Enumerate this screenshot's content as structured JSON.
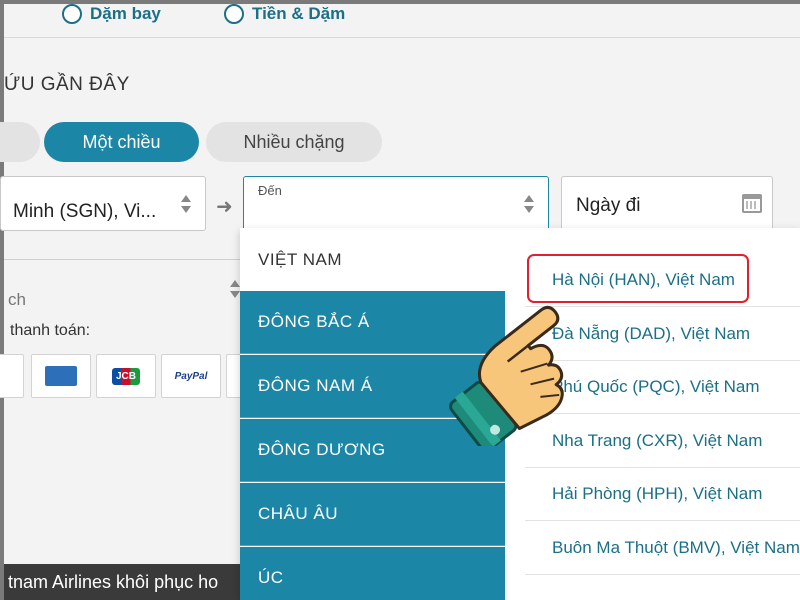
{
  "fare_options": {
    "miles": "Dặm bay",
    "cash_miles": "Tiền & Dặm"
  },
  "recent_searches_title": "ỨU GẦN ĐÂY",
  "trip_type": {
    "one_way": "Một chiều",
    "multi_city": "Nhiều chặng"
  },
  "origin": {
    "value": "Minh (SGN), Vi..."
  },
  "destination": {
    "label": "Đến",
    "value": ""
  },
  "date": {
    "placeholder": "Ngày đi"
  },
  "left_field": {
    "value": "ch"
  },
  "payment_label": "thanh toán:",
  "payment_cards": [
    "american-express",
    "jcb",
    "paypal"
  ],
  "payment_card_text": {
    "jcb": "JCB",
    "paypal": "PayPal"
  },
  "bottom_notice": "tnam Airlines khôi phục ho",
  "regions": [
    "VIỆT NAM",
    "ĐÔNG BẮC Á",
    "ĐÔNG NAM Á",
    "ĐÔNG DƯƠNG",
    "CHÂU ÂU",
    "ÚC"
  ],
  "selected_region": "VIỆT NAM",
  "cities": [
    "Hà Nội (HAN), Việt Nam",
    "Đà Nẵng (DAD), Việt Nam",
    "Phú Quốc (PQC), Việt Nam",
    "Nha Trang (CXR), Việt Nam",
    "Hải Phòng (HPH), Việt Nam",
    "Buôn Ma Thuột (BMV), Việt Nam"
  ],
  "highlighted_city": "Hà Nội (HAN), Việt Nam",
  "colors": {
    "primary": "#1b86a6",
    "text_link": "#1b6f87",
    "highlight": "#e0202f"
  }
}
